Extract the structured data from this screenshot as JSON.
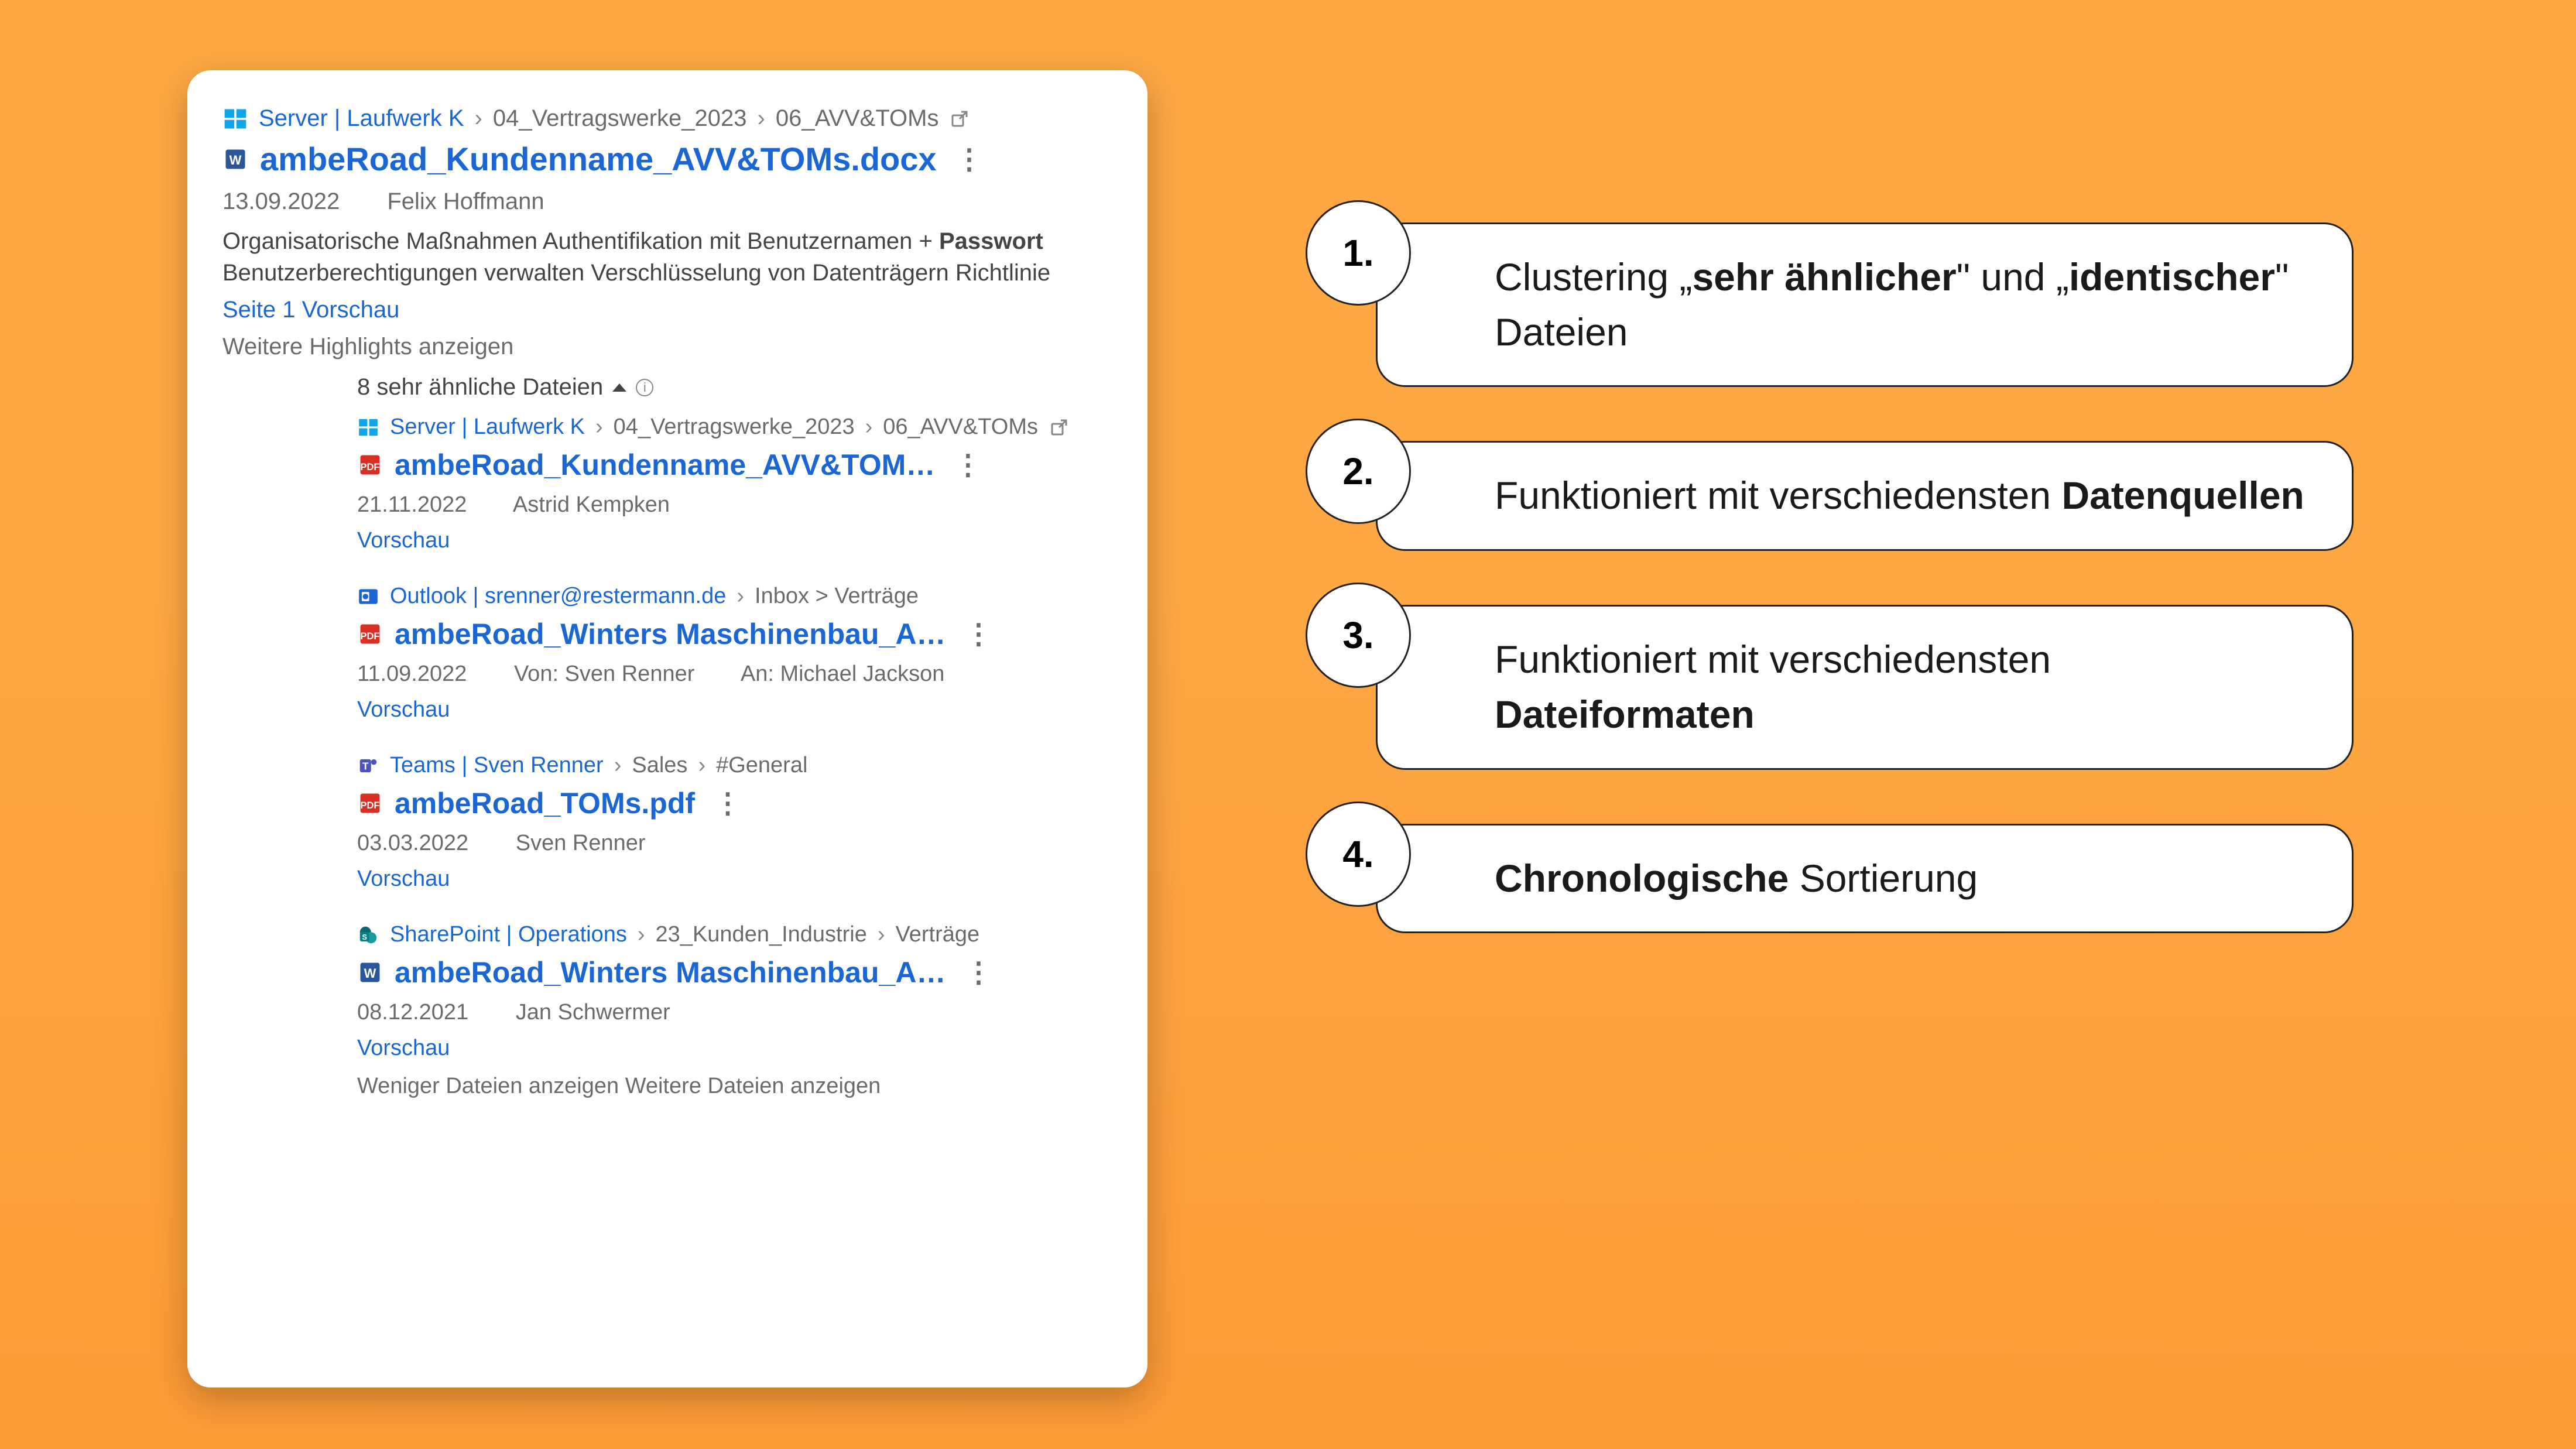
{
  "main": {
    "breadcrumb": {
      "source": "Server | Laufwerk K",
      "p1": "04_Vertragswerke_2023",
      "p2": "06_AVV&TOMs"
    },
    "title": "ambeRoad_Kundenname_AVV&TOMs.docx",
    "date": "13.09.2022",
    "author": "Felix Hoffmann",
    "snippet_pre": "Organisatorische Maßnahmen Authentifikation mit Benutzernamen + ",
    "snippet_bold": "Passwort",
    "snippet_post": " Benutzerberechtigungen verwalten Verschlüsselung von Datenträgern Richtlinie",
    "preview": "Seite 1 Vorschau",
    "more_highlights": "Weitere Highlights anzeigen"
  },
  "cluster": {
    "header": "8 sehr ähnliche Dateien"
  },
  "results": [
    {
      "source_type": "windows",
      "source_label": "Server | Laufwerk K",
      "path": [
        "04_Vertragswerke_2023",
        "06_AVV&TOMs"
      ],
      "file_icon": "pdf",
      "title": "ambeRoad_Kundenname_AVV&TOM…",
      "date": "21.11.2022",
      "author": "Astrid Kempken",
      "preview": "Vorschau"
    },
    {
      "source_type": "outlook",
      "source_label": "Outlook | srenner@restermann.de",
      "path_joined": "Inbox > Verträge",
      "file_icon": "pdf",
      "title": "ambeRoad_Winters Maschinenbau_A…",
      "date": "11.09.2022",
      "from_label": "Von: Sven Renner",
      "to_label": "An: Michael Jackson",
      "preview": "Vorschau"
    },
    {
      "source_type": "teams",
      "source_label": "Teams | Sven Renner",
      "path": [
        "Sales",
        "#General"
      ],
      "file_icon": "pdf",
      "title": "ambeRoad_TOMs.pdf",
      "date": "03.03.2022",
      "author": "Sven Renner",
      "preview": "Vorschau"
    },
    {
      "source_type": "sharepoint",
      "source_label": "SharePoint | Operations",
      "path": [
        "23_Kunden_Industrie",
        "Verträge"
      ],
      "file_icon": "word",
      "title": "ambeRoad_Winters Maschinenbau_A…",
      "date": "08.12.2021",
      "author": "Jan Schwermer",
      "preview": "Vorschau"
    }
  ],
  "footer": {
    "less": "Weniger Dateien anzeigen",
    "more": "Weitere Dateien anzeigen"
  },
  "callouts": [
    {
      "num": "1.",
      "pre": "Clustering „",
      "b1": "sehr ähnlicher",
      "mid": "\" und „",
      "b2": "identischer",
      "post": "\" Dateien"
    },
    {
      "num": "2.",
      "pre": "Funktioniert mit verschiedensten ",
      "b1": "Datenquellen",
      "mid": "",
      "b2": "",
      "post": ""
    },
    {
      "num": "3.",
      "pre": "Funktioniert mit verschiedensten ",
      "b1": "Dateiformaten",
      "mid": "",
      "b2": "",
      "post": ""
    },
    {
      "num": "4.",
      "pre": "",
      "b1": "Chronologische",
      "mid": " Sortierung",
      "b2": "",
      "post": ""
    }
  ]
}
